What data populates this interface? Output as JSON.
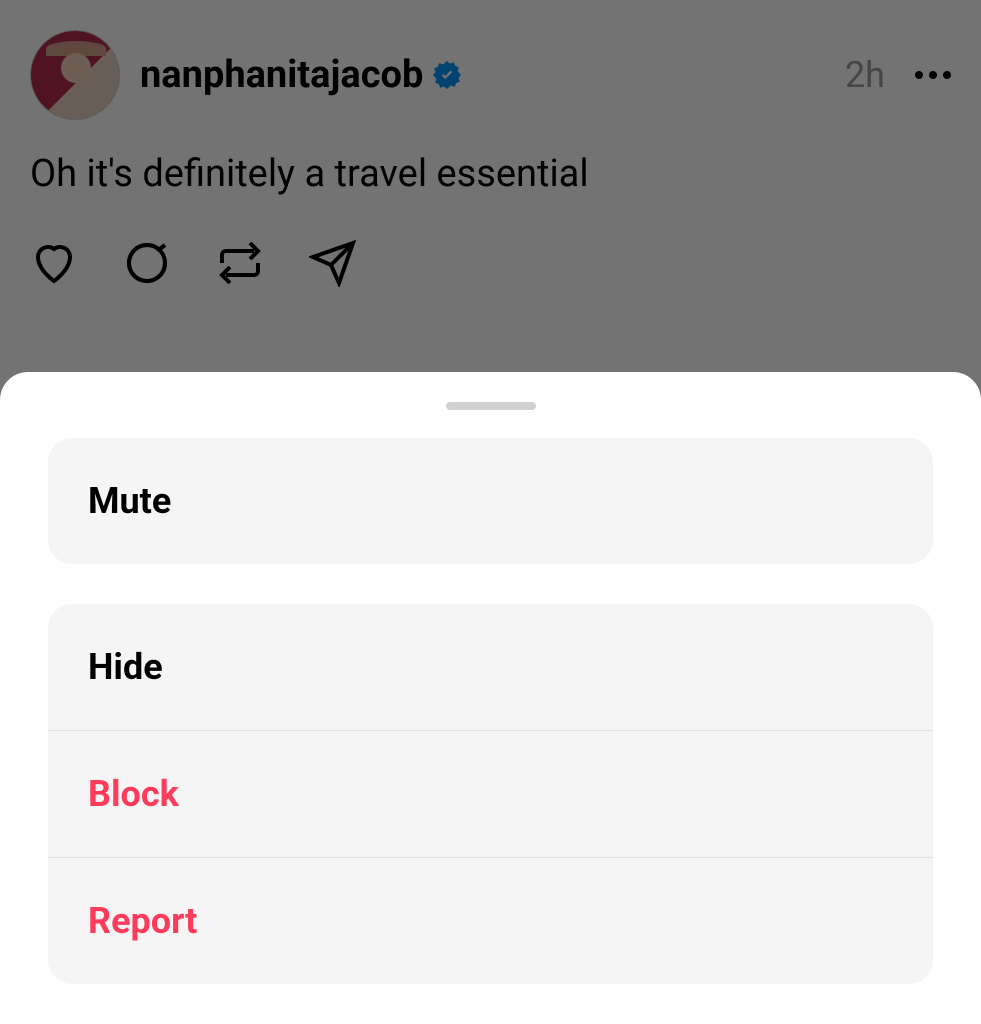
{
  "post": {
    "username": "nanphanitajacob",
    "verified": true,
    "timestamp": "2h",
    "text": "Oh it's definitely a travel essential"
  },
  "actions": {
    "like": "like",
    "reply": "reply",
    "repost": "repost",
    "share": "share"
  },
  "menu": {
    "group1": [
      {
        "label": "Mute",
        "destructive": false
      }
    ],
    "group2": [
      {
        "label": "Hide",
        "destructive": false
      },
      {
        "label": "Block",
        "destructive": true
      },
      {
        "label": "Report",
        "destructive": true
      }
    ]
  },
  "colors": {
    "destructive": "#ff3b5c",
    "verified": "#0095f6"
  }
}
